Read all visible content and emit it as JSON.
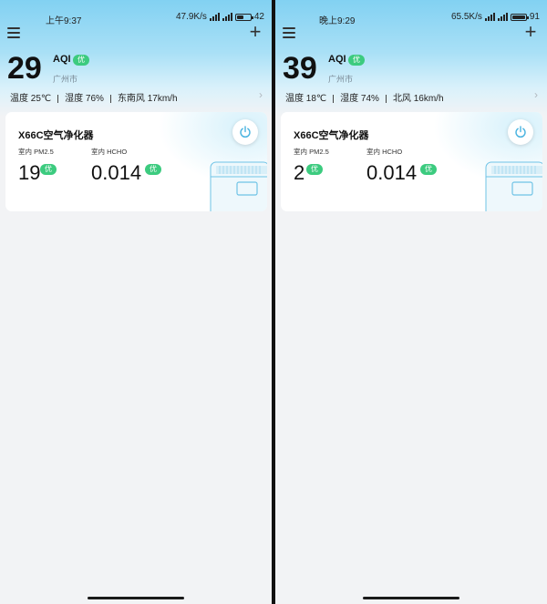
{
  "screens": [
    {
      "status": {
        "time": "上午9:37",
        "speed": "47.9K/s",
        "battery": "42",
        "battery_fill": 0.42
      },
      "aqi": {
        "value": "29",
        "label": "AQI",
        "badge": "优"
      },
      "city": "广州市",
      "weather": {
        "temp": "温度 25℃",
        "humidity": "湿度 76%",
        "wind": "东南风 17km/h"
      },
      "device": {
        "name": "X66C空气净化器",
        "pm25_label": "室内 PM2.5",
        "pm25_value": "19",
        "pm25_badge": "优",
        "hcho_label": "室内 HCHO",
        "hcho_value": "0.014",
        "hcho_badge": "优"
      }
    },
    {
      "status": {
        "time": "晚上9:29",
        "speed": "65.5K/s",
        "battery": "91",
        "battery_fill": 0.91
      },
      "aqi": {
        "value": "39",
        "label": "AQI",
        "badge": "优"
      },
      "city": "广州市",
      "weather": {
        "temp": "温度 18℃",
        "humidity": "湿度 74%",
        "wind": "北风 16km/h"
      },
      "device": {
        "name": "X66C空气净化器",
        "pm25_label": "室内 PM2.5",
        "pm25_value": "2",
        "pm25_badge": "优",
        "hcho_label": "室内 HCHO",
        "hcho_value": "0.014",
        "hcho_badge": "优"
      }
    }
  ],
  "icons": {
    "menu": "menu-icon",
    "add": "plus-icon",
    "power": "power-icon",
    "chevron": "chevron-right-icon",
    "signal": "signal-icon",
    "battery": "battery-icon",
    "device": "air-purifier-icon"
  },
  "colors": {
    "badge_green": "#3ccb7f",
    "hero_top": "#82d1f2",
    "background": "#f2f3f5",
    "power_ring": "#49b3e0"
  }
}
